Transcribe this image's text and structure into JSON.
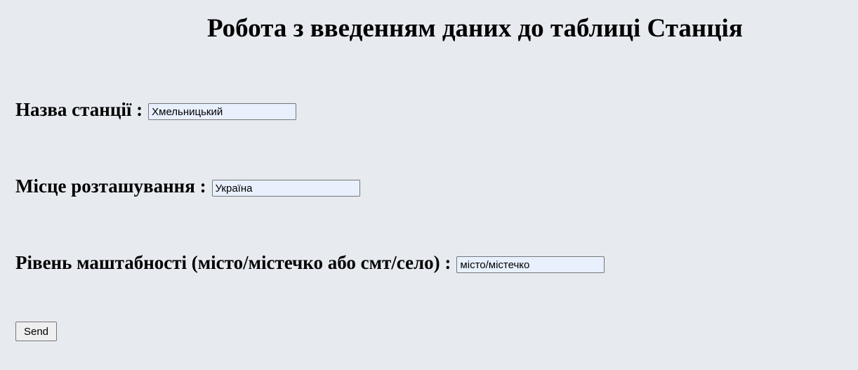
{
  "page": {
    "title": "Робота з введенням даних до таблиці Станція"
  },
  "form": {
    "station_name": {
      "label": "Назва станції :",
      "value": "Хмельницький"
    },
    "location": {
      "label": "Місце розташування :",
      "value": "Україна"
    },
    "scale_level": {
      "label": "Рівень маштабності (місто/містечко або смт/село) :",
      "value": "місто/містечко"
    },
    "submit_label": "Send"
  }
}
